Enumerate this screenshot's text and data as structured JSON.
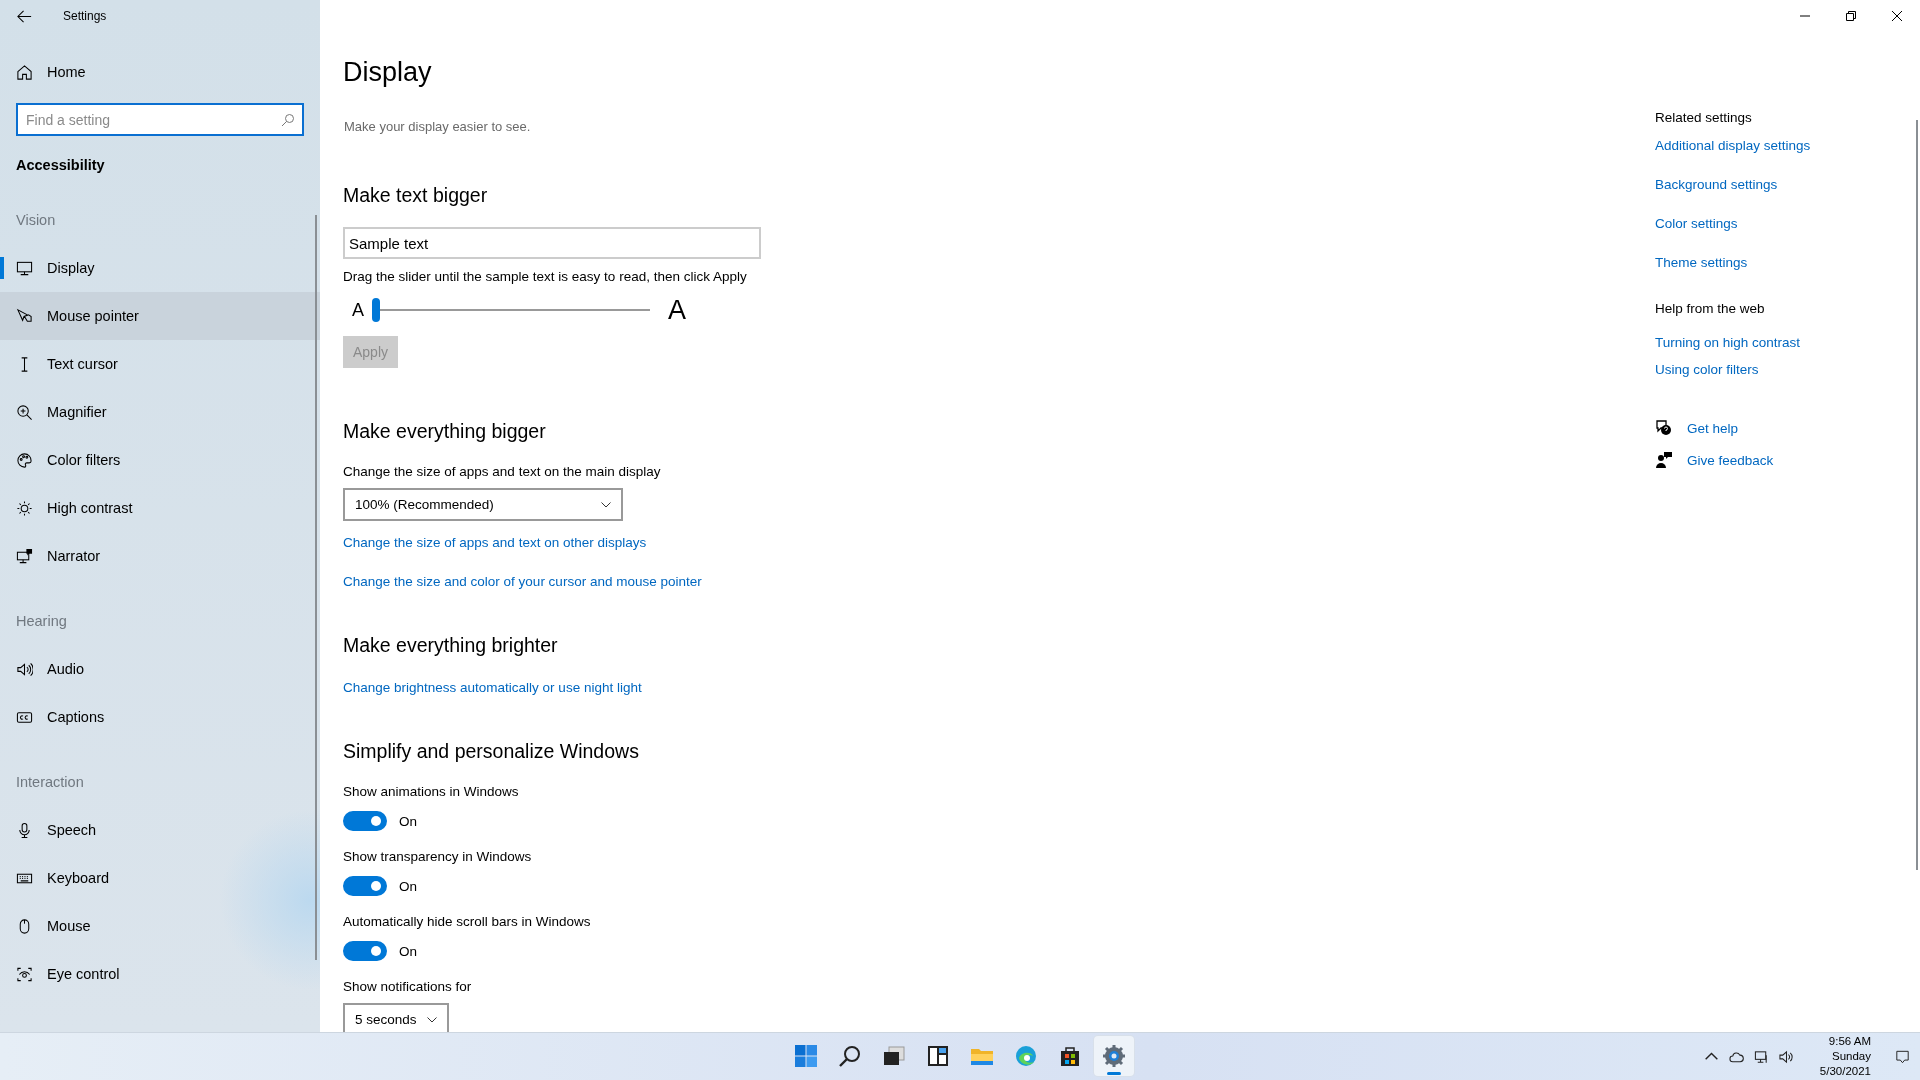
{
  "window": {
    "title": "Settings"
  },
  "sidebar": {
    "home": "Home",
    "search": {
      "placeholder": "Find a setting",
      "focused": true
    },
    "category": "Accessibility",
    "groups": [
      {
        "heading": "Vision",
        "items": [
          {
            "label": "Display",
            "selected": true,
            "hovered": false
          },
          {
            "label": "Mouse pointer",
            "selected": false,
            "hovered": true
          },
          {
            "label": "Text cursor",
            "selected": false,
            "hovered": false
          },
          {
            "label": "Magnifier",
            "selected": false,
            "hovered": false
          },
          {
            "label": "Color filters",
            "selected": false,
            "hovered": false
          },
          {
            "label": "High contrast",
            "selected": false,
            "hovered": false
          },
          {
            "label": "Narrator",
            "selected": false,
            "hovered": false
          }
        ]
      },
      {
        "heading": "Hearing",
        "items": [
          {
            "label": "Audio",
            "selected": false,
            "hovered": false
          },
          {
            "label": "Captions",
            "selected": false,
            "hovered": false
          }
        ]
      },
      {
        "heading": "Interaction",
        "items": [
          {
            "label": "Speech",
            "selected": false,
            "hovered": false
          },
          {
            "label": "Keyboard",
            "selected": false,
            "hovered": false
          },
          {
            "label": "Mouse",
            "selected": false,
            "hovered": false
          },
          {
            "label": "Eye control",
            "selected": false,
            "hovered": false
          }
        ]
      }
    ]
  },
  "page": {
    "title": "Display",
    "subtitle": "Make your display easier to see.",
    "sections": [
      {
        "heading": "Make text bigger",
        "parts": [
          {
            "kind": "sample",
            "value": "Sample text"
          },
          {
            "kind": "label",
            "text": "Drag the slider until the sample text is easy to read, then click Apply"
          },
          {
            "kind": "slider",
            "small": "A",
            "large": "A",
            "level": 0.0
          },
          {
            "kind": "button",
            "label": "Apply",
            "disabled": true
          }
        ]
      },
      {
        "heading": "Make everything bigger",
        "parts": [
          {
            "kind": "label",
            "text": "Change the size of apps and text on the main display"
          },
          {
            "kind": "dropdown",
            "value": "100% (Recommended)",
            "wide": true
          },
          {
            "kind": "link",
            "text": "Change the size of apps and text on other displays"
          },
          {
            "kind": "link",
            "text": "Change the size and color of your cursor and mouse pointer"
          }
        ]
      },
      {
        "heading": "Make everything brighter",
        "parts": [
          {
            "kind": "link",
            "text": "Change brightness automatically or use night light"
          }
        ]
      },
      {
        "heading": "Simplify and personalize Windows",
        "parts": [
          {
            "kind": "label",
            "text": "Show animations in Windows"
          },
          {
            "kind": "toggle",
            "on": true,
            "state_text": "On"
          },
          {
            "kind": "label",
            "text": "Show transparency in Windows"
          },
          {
            "kind": "toggle",
            "on": true,
            "state_text": "On"
          },
          {
            "kind": "label",
            "text": "Automatically hide scroll bars in Windows"
          },
          {
            "kind": "toggle",
            "on": true,
            "state_text": "On"
          },
          {
            "kind": "label",
            "text": "Show notifications for"
          },
          {
            "kind": "dropdown",
            "value": "5 seconds",
            "wide": false
          }
        ]
      }
    ]
  },
  "related": {
    "heading": "Related settings",
    "links": [
      "Additional display settings",
      "Background settings",
      "Color settings",
      "Theme settings"
    ]
  },
  "help": {
    "heading": "Help from the web",
    "links": [
      "Turning on high contrast",
      "Using color filters"
    ]
  },
  "support": [
    "Get help",
    "Give feedback"
  ],
  "taskbar": {
    "apps": [
      {
        "active": false
      },
      {
        "active": false
      },
      {
        "active": false
      },
      {
        "active": false
      },
      {
        "active": false
      },
      {
        "active": false
      },
      {
        "active": false
      },
      {
        "active": true
      }
    ],
    "clock": {
      "time": "9:56 AM",
      "day": "Sunday",
      "date": "5/30/2021"
    }
  }
}
